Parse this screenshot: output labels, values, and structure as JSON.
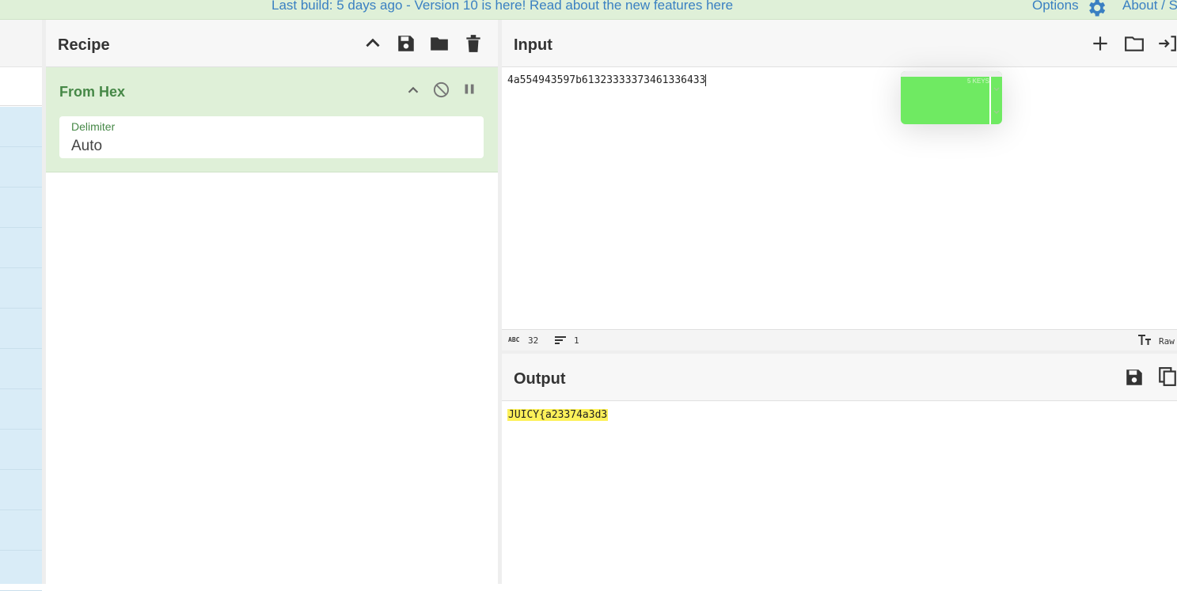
{
  "banner": {
    "text": "Last build: 5 days ago - Version 10 is here! Read about the new features here",
    "options_label": "Options",
    "about_label": "About / S"
  },
  "recipe": {
    "title": "Recipe",
    "operation": {
      "name": "From Hex",
      "field_label": "Delimiter",
      "field_value": "Auto"
    }
  },
  "input": {
    "title": "Input",
    "text": "4a554943597b61323333373461336433",
    "stats": {
      "length": "32",
      "lines": "1",
      "format": "Raw"
    }
  },
  "output": {
    "title": "Output",
    "text": "JUICY{a23374a3d3"
  },
  "popup": {
    "label": "5 KEYS"
  },
  "colors": {
    "link": "#3a80c2",
    "recipe_active": "#dff0d8",
    "operation_text": "#468847",
    "highlight": "#fdf15a",
    "popup": "#6fea62"
  }
}
